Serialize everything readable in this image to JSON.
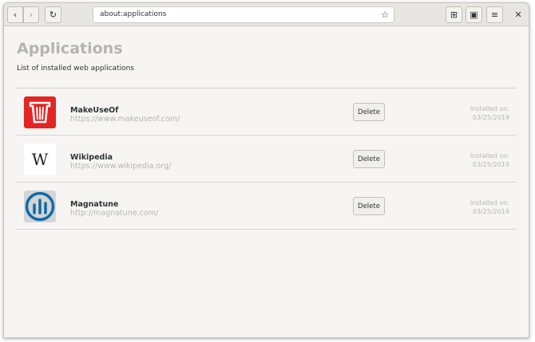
{
  "header": {
    "url": "about:applications"
  },
  "page": {
    "title": "Applications",
    "subtitle": "List of installed web applications"
  },
  "apps": [
    {
      "name": "MakeUseOf",
      "url": "https://www.makeuseof.com/",
      "delete": "Delete",
      "installed_label": "Installed on:",
      "installed_date": "03/25/2019"
    },
    {
      "name": "Wikipedia",
      "url": "https://www.wikipedia.org/",
      "delete": "Delete",
      "installed_label": "Installed on:",
      "installed_date": "03/25/2019"
    },
    {
      "name": "Magnatune",
      "url": "http://magnatune.com/",
      "delete": "Delete",
      "installed_label": "Installed on:",
      "installed_date": "03/25/2019"
    }
  ]
}
